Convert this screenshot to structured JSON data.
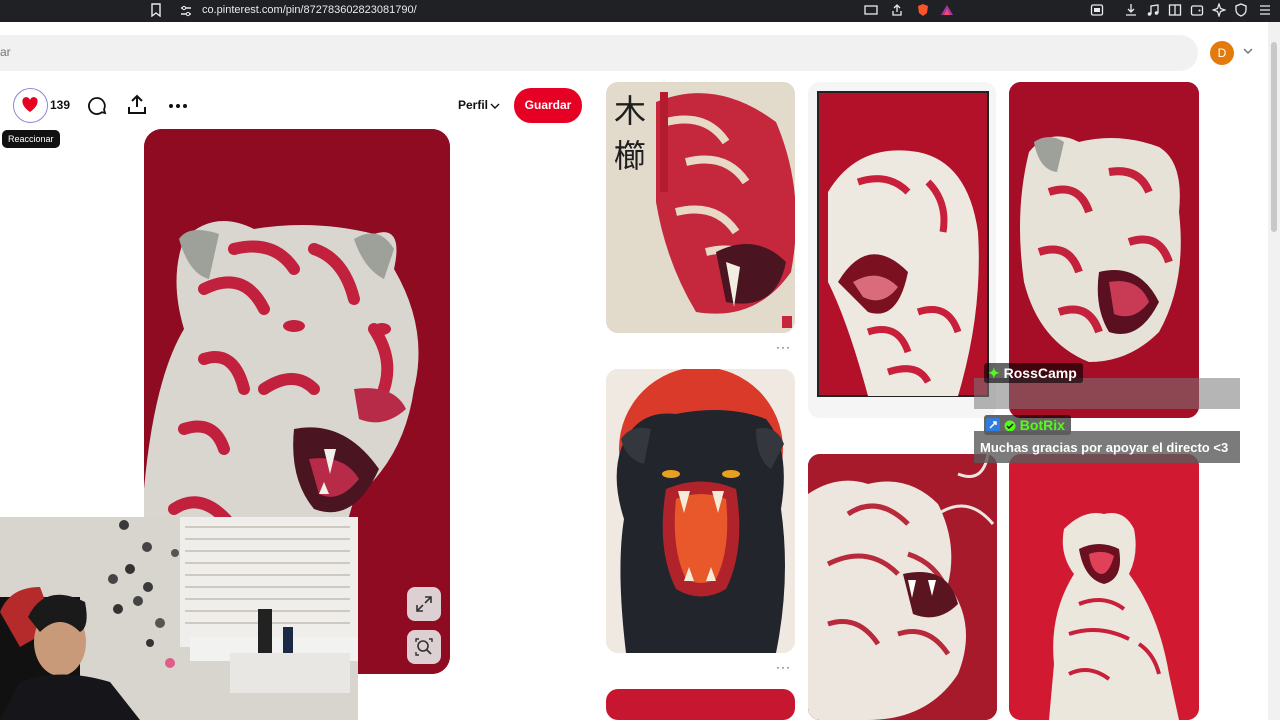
{
  "browser": {
    "url": "co.pinterest.com/pin/872783602823081790/"
  },
  "header": {
    "avatar_initial": "D"
  },
  "pin": {
    "reaction_count": "139",
    "reaction_tooltip": "Reaccionar",
    "profile_label": "Perfil",
    "save_label": "Guardar"
  },
  "chat": {
    "user1": "RossCamp",
    "user2": "BotRix",
    "message": "Muchas gracias por apoyar el directo <3"
  },
  "colors": {
    "brand_red": "#e60023",
    "tiger_red": "#8e0b22",
    "react_outline": "#8f86d6"
  }
}
